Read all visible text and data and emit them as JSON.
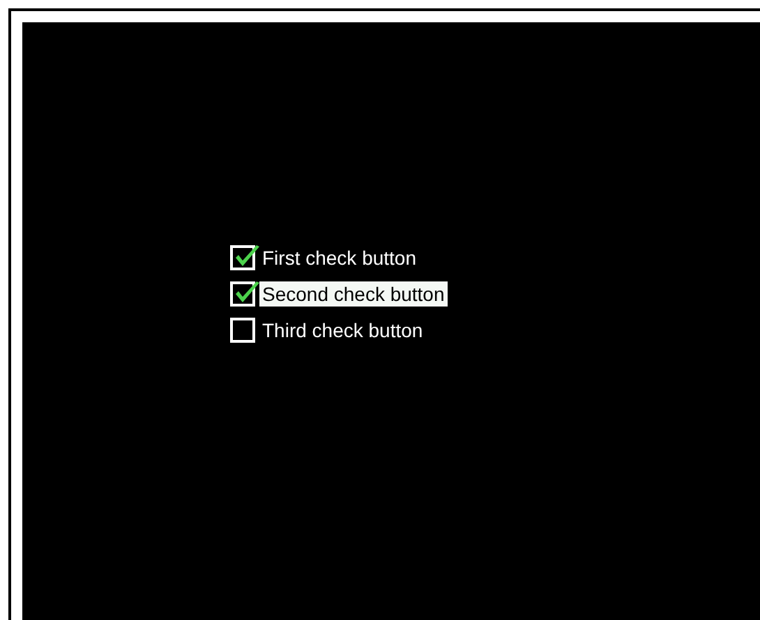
{
  "check_buttons": [
    {
      "label": "First check button",
      "checked": true,
      "selected": false
    },
    {
      "label": "Second check button",
      "checked": true,
      "selected": true
    },
    {
      "label": "Third check button",
      "checked": false,
      "selected": false
    }
  ]
}
